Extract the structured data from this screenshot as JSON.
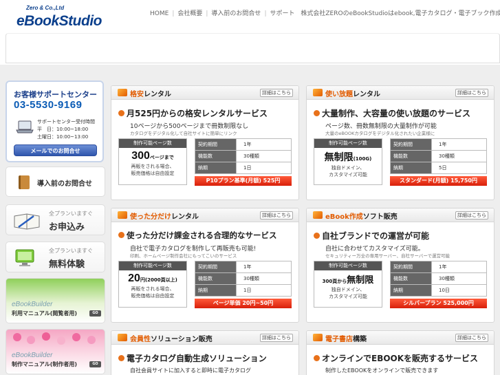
{
  "header": {
    "logo_small": "Zero & Co.,Ltd",
    "logo_main": "eBookStudio",
    "nav": [
      "HOME",
      "会社概要",
      "導入前のお問合せ",
      "サポート"
    ],
    "tagline": "株式会社ZEROのeBookStudioはebook,電子カタログ・電子ブック作成ソフトの販売・制作代行を行っています"
  },
  "sidebar": {
    "support_title": "お客様サポートセンター",
    "support_phone": "03-5530-9169",
    "support_hours_title": "サポートセンター受付時間",
    "support_weekday": "平　日：10:00~18:00",
    "support_saturday": "土曜日：10:00~13:00",
    "mail_button": "メールでのお問合せ",
    "inquiry": "導入前のお問合せ",
    "apply_small": "全プランいますぐ",
    "apply_large": "お申込み",
    "trial_small": "全プランいますぐ",
    "trial_large": "無料体験",
    "manual1_brand": "eBookBuilder",
    "manual1_label": "利用マニュアル(閲覧者用)",
    "manual2_brand": "eBookBuilder",
    "manual2_label": "制作マニュアル(制作者用)",
    "go": "GO"
  },
  "cards": [
    {
      "title_accent": "格安",
      "title_rest": "レンタル",
      "details": "詳細はこちら",
      "headline": "月525円からの格安レンタルサービス",
      "sub1": "10ページから500ページまで冊数制限なし",
      "sub2": "カタログをデジタル化して自社サイトに簡単にリンク",
      "pages_header": "制作可能ページ数",
      "pages_value": "300",
      "pages_unit": "ページまで",
      "note1": "再販をされる場合、",
      "note2": "販売価格は自由設定",
      "spec": [
        {
          "k": "契約期間",
          "v": "1年"
        },
        {
          "k": "機能数",
          "v": "30種類"
        },
        {
          "k": "納期",
          "v": "1日"
        }
      ],
      "plan": "P10プラン基準(月額) 525円"
    },
    {
      "title_accent": "使い放題",
      "title_rest": "レンタル",
      "details": "詳細はこちら",
      "headline": "大量制作、大容量の使い放題のサービス",
      "sub1": "ページ数、冊数無制限の大量制作が可能",
      "sub2": "大量のeBOOKカタログをデジタル化されたい企業様に",
      "pages_header": "制作可能ページ数",
      "pages_value": "無制限",
      "pages_unit": "(100G)",
      "note1": "独自ドメイン、",
      "note2": "カスタマイズ可能",
      "spec": [
        {
          "k": "契約期間",
          "v": "1年"
        },
        {
          "k": "機能数",
          "v": "30種類"
        },
        {
          "k": "納期",
          "v": "5日"
        }
      ],
      "plan": "スタンダード(月額) 15,750円"
    },
    {
      "title_accent": "使った分だけ",
      "title_rest": "レンタル",
      "details": "詳細はこちら",
      "headline": "使った分だけ課金される合理的なサービス",
      "sub1": "自社で電子カタログを制作して再販売も可能!",
      "sub2": "印刷、ホームページ制作会社にもってこいのサービス",
      "pages_header": "制作可能ページ数",
      "pages_value": "20",
      "pages_unit": "円(2000頁以上)",
      "note1": "再販をされる場合、",
      "note2": "販売価格は自由設定",
      "spec": [
        {
          "k": "契約期間",
          "v": "1年"
        },
        {
          "k": "機能数",
          "v": "30種類"
        },
        {
          "k": "納期",
          "v": "1日"
        }
      ],
      "plan": "ページ単価 20円~50円"
    },
    {
      "title_accent": "eBook作成",
      "title_rest": "ソフト販売",
      "details": "詳細はこちら",
      "headline": "自社ブランドでの運営が可能",
      "sub1": "自社に合わせてカスタマイズ可能。",
      "sub2": "セキュリティー万全の専用サーバー、自社サーバーで運営可能",
      "pages_header": "制作可能ページ数",
      "pages_value": "無制限",
      "pages_unit": "300頁から",
      "note1": "独自ドメイン、",
      "note2": "カスタマイズ可能",
      "spec": [
        {
          "k": "契約期間",
          "v": "1年"
        },
        {
          "k": "機能数",
          "v": "30種類"
        },
        {
          "k": "納期",
          "v": "10日"
        }
      ],
      "plan": "シルバープラン 525,000円"
    },
    {
      "title_accent": "会員性",
      "title_rest": "ソリューション販売",
      "details": "詳細はこちら",
      "headline": "電子カタログ自動生成ソリューション",
      "sub1": "自社会員サイトに加入すると即時に電子カタログ"
    },
    {
      "title_accent": "電子書店",
      "title_rest": "構築",
      "details": "詳細はこちら",
      "headline": "オンラインでEBOOKを販売するサービス",
      "sub1": "制作したEBOOKをオンラインで販売できます"
    }
  ]
}
